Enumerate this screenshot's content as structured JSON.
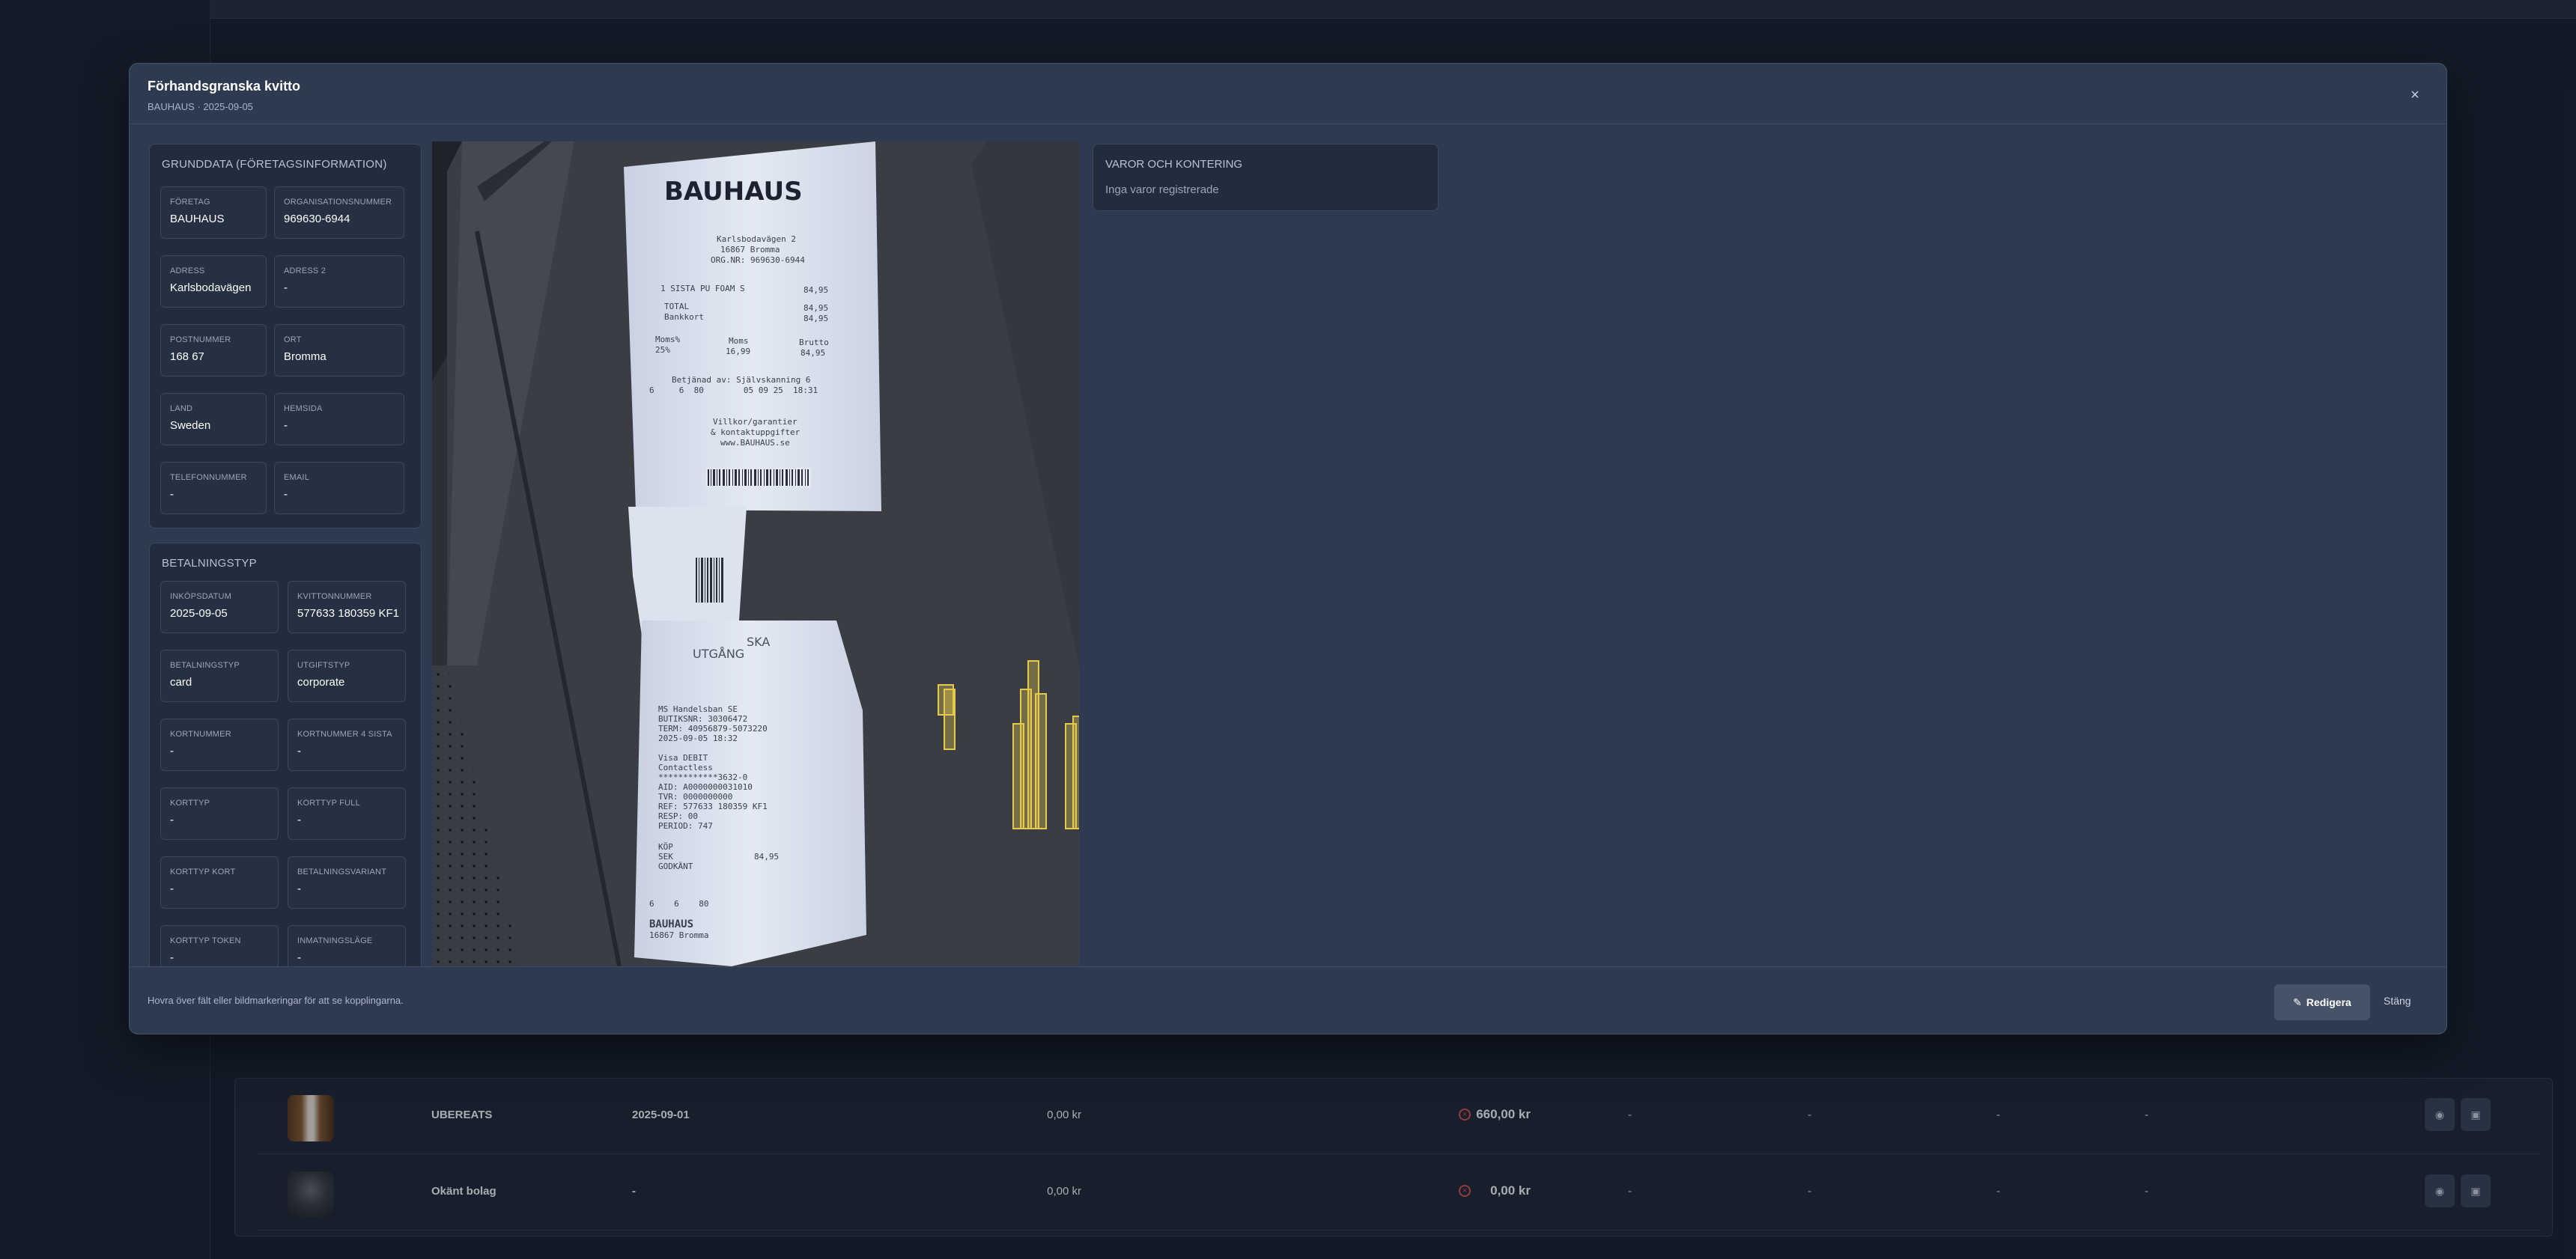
{
  "modal": {
    "title": "Förhandsgranska kvitto",
    "subtitle": "BAUHAUS · 2025-09-05",
    "close_symbol": "×"
  },
  "company_panel": {
    "title": "GRUNDDATA (FÖRETAGSINFORMATION)",
    "fields": [
      {
        "label": "FÖRETAG",
        "value": "BAUHAUS"
      },
      {
        "label": "ORGANISATIONSNUMMER",
        "value": "969630-6944"
      },
      {
        "label": "ADRESS",
        "value": "Karlsbodavägen"
      },
      {
        "label": "ADRESS 2",
        "value": "-"
      },
      {
        "label": "POSTNUMMER",
        "value": "168 67"
      },
      {
        "label": "ORT",
        "value": "Bromma"
      },
      {
        "label": "LAND",
        "value": "Sweden"
      },
      {
        "label": "HEMSIDA",
        "value": "-"
      },
      {
        "label": "TELEFONNUMMER",
        "value": "-"
      },
      {
        "label": "EMAIL",
        "value": "-"
      }
    ]
  },
  "payment_panel": {
    "title": "BETALNINGSTYP",
    "fields": [
      {
        "label": "INKÖPSDATUM",
        "value": "2025-09-05"
      },
      {
        "label": "KVITTONNUMMER",
        "value": "577633 180359 KF1"
      },
      {
        "label": "BETALNINGSTYP",
        "value": "card"
      },
      {
        "label": "UTGIFTSTYP",
        "value": "corporate"
      },
      {
        "label": "KORTNUMMER",
        "value": "-"
      },
      {
        "label": "KORTNUMMER 4 SISTA",
        "value": "-"
      },
      {
        "label": "KORTTYP",
        "value": "-"
      },
      {
        "label": "KORTTYP FULL",
        "value": "-"
      },
      {
        "label": "KORTTYP KORT",
        "value": "-"
      },
      {
        "label": "BETALNINGSVARIANT",
        "value": "-"
      },
      {
        "label": "KORTTYP TOKEN",
        "value": "-"
      },
      {
        "label": "INMATNINGSLÄGE",
        "value": "-"
      }
    ]
  },
  "receipt": {
    "logo": "BAUHAUS",
    "header_lines": [
      "Karlsbodavägen 2",
      "16867 Bromma",
      "ORG.NR: 969630-6944"
    ],
    "item_line": "1 SISTA PU FOAM S",
    "item_price": "84,95",
    "total_label": "TOTAL",
    "total_value": "84,95",
    "bankkort_label": "Bankkort",
    "bankkort_value": "84,95",
    "vat_headers": [
      "Moms%",
      "Moms",
      "Brutto"
    ],
    "vat_values": [
      "25%",
      "16,99",
      "84,95"
    ],
    "served_by": "Betjänad av: Självskanning 6",
    "register_line": "6     6  80        05 09 25  18:31",
    "terms_lines": [
      "Villkor/garantier",
      "& kontaktuppgifter",
      "www.BAUHAUS.se"
    ],
    "exit_text_1": "SKA",
    "exit_text_2": "UTGÅNG",
    "card_lines": [
      "MS Handelsban SE",
      "BUTIKSNR: 30306472",
      "TERM: 40956879-5073220",
      "2025-09-05 18:32",
      "",
      "Visa DEBIT",
      "Contactless",
      "************3632-0",
      "AID: A0000000031010",
      "TVR: 0000000000",
      "REF: 577633 180359 KF1",
      "RESP: 00",
      "PERIOD: 747"
    ],
    "kop_label": "KÖP",
    "sek_label": "SEK",
    "sek_value": "84,95",
    "approved": "GODKÄNT",
    "footer_line": "6    6    80",
    "footer_brand": "BAUHAUS",
    "footer_city": "16867 Bromma"
  },
  "items_panel": {
    "title": "VAROR OCH KONTERING",
    "empty_text": "Inga varor registrerade"
  },
  "footer": {
    "hint": "Hovra över fält eller bildmarkeringar för att se kopplingarna.",
    "edit_label": "Redigera",
    "edit_icon": "✎",
    "close_label": "Stäng"
  },
  "background_table": {
    "rows": [
      {
        "company": "UBEREATS",
        "date": "2025-09-01",
        "amount_1": "0,00 kr",
        "amount_2": "660,00 kr",
        "status_icon": "x-circle-icon",
        "dashes": [
          "-",
          "-",
          "-",
          "-"
        ]
      },
      {
        "company": "Okänt bolag",
        "date": "-",
        "amount_1": "0,00 kr",
        "amount_2": "0,00 kr",
        "status_icon": "x-circle-icon",
        "dashes": [
          "-",
          "-",
          "-",
          "-"
        ]
      }
    ],
    "status_symbol": "×"
  },
  "colors": {
    "background": "#192130",
    "modal": "#2e3a4f",
    "panel": "#222c3c",
    "error": "#e05252",
    "highlight": "#e6c84a"
  }
}
